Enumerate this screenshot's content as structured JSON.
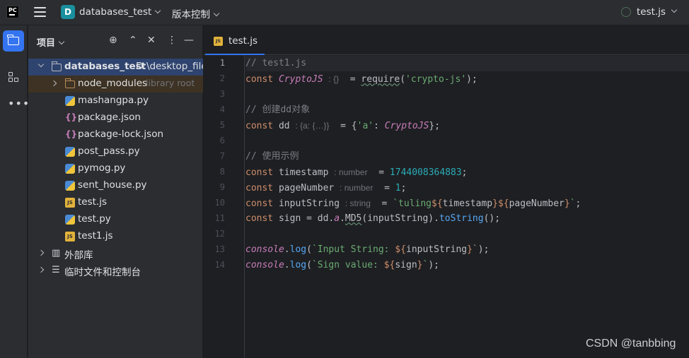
{
  "titlebar": {
    "logo": "PC",
    "project_initial": "D",
    "project_name": "databases_test",
    "vcs_label": "版本控制",
    "run_config": "test.js"
  },
  "project_panel": {
    "title": "项目",
    "tree": [
      {
        "label": "databases_test",
        "hint": "D:\\desktop_file",
        "type": "folder-root"
      },
      {
        "label": "node_modules",
        "hint": "library root",
        "type": "folder-excluded"
      },
      {
        "label": "mashangpa.py",
        "type": "py"
      },
      {
        "label": "package.json",
        "type": "json"
      },
      {
        "label": "package-lock.json",
        "type": "json"
      },
      {
        "label": "post_pass.py",
        "type": "py"
      },
      {
        "label": "pymog.py",
        "type": "py"
      },
      {
        "label": "sent_house.py",
        "type": "py"
      },
      {
        "label": "test.js",
        "type": "js"
      },
      {
        "label": "test.py",
        "type": "py"
      },
      {
        "label": "test1.js",
        "type": "js"
      },
      {
        "label": "外部库",
        "type": "lib"
      },
      {
        "label": "临时文件和控制台",
        "type": "scratch"
      }
    ]
  },
  "editor": {
    "tab_label": "test.js",
    "line_numbers": [
      "1",
      "2",
      "3",
      "4",
      "5",
      "6",
      "7",
      "8",
      "9",
      "10",
      "11",
      "12",
      "13",
      "14"
    ],
    "lines": {
      "l1_comment": "// test1.js",
      "l2_const": "const ",
      "l2_name": "CryptoJS",
      "l2_hint": ": {}",
      "l2_eq": "  = ",
      "l2_require": "require",
      "l2_open": "(",
      "l2_str": "'crypto-js'",
      "l2_close": ");",
      "l4_comment": "// 创建dd对象",
      "l5_const": "const ",
      "l5_name": "dd",
      "l5_hint": ": {a: {…}}",
      "l5_eq": "  = {",
      "l5_key": "'a'",
      "l5_colon": ": ",
      "l5_val": "CryptoJS",
      "l5_close": "};",
      "l7_comment": "// 使用示例",
      "l8_const": "const ",
      "l8_name": "timestamp",
      "l8_hint": ": number",
      "l8_eq": "  = ",
      "l8_val": "1744008364883",
      "l8_end": ";",
      "l9_const": "const ",
      "l9_name": "pageNumber",
      "l9_hint": ": number",
      "l9_eq": "  = ",
      "l9_val": "1",
      "l9_end": ";",
      "l10_const": "const ",
      "l10_name": "inputString",
      "l10_hint": ": string",
      "l10_eq": "  = ",
      "l10_tpl1": "`tuling",
      "l10_tpl2": "${",
      "l10_tpl3": "timestamp",
      "l10_tpl4": "}${",
      "l10_tpl5": "pageNumber",
      "l10_tpl6": "}",
      "l10_tpl7": "`",
      "l10_end": ";",
      "l11_const": "const ",
      "l11_name": "sign = dd.",
      "l11_a": "a",
      "l11_dot": ".",
      "l11_md5": "MD5",
      "l11_args": "(inputString).",
      "l11_tostr": "toString",
      "l11_end": "();",
      "l13_console": "console",
      "l13_dot": ".",
      "l13_log": "log",
      "l13_open": "(",
      "l13_tpl": "`Input String: ",
      "l13_ph1": "${",
      "l13_var": "inputString",
      "l13_ph2": "}",
      "l13_tpl_end": "`",
      "l13_close": ");",
      "l14_console": "console",
      "l14_dot": ".",
      "l14_log": "log",
      "l14_open": "(",
      "l14_tpl": "`Sign value: ",
      "l14_ph1": "${",
      "l14_var": "sign",
      "l14_ph2": "}",
      "l14_tpl_end": "`",
      "l14_close": ");"
    }
  },
  "watermark": "CSDN @tanbbing",
  "colors": {
    "accent": "#3574f0",
    "background": "#1e1f22",
    "panel": "#2b2d30",
    "keyword": "#cf8e6d",
    "string": "#6aab73",
    "number": "#2aacb8",
    "comment": "#7a7e85"
  }
}
